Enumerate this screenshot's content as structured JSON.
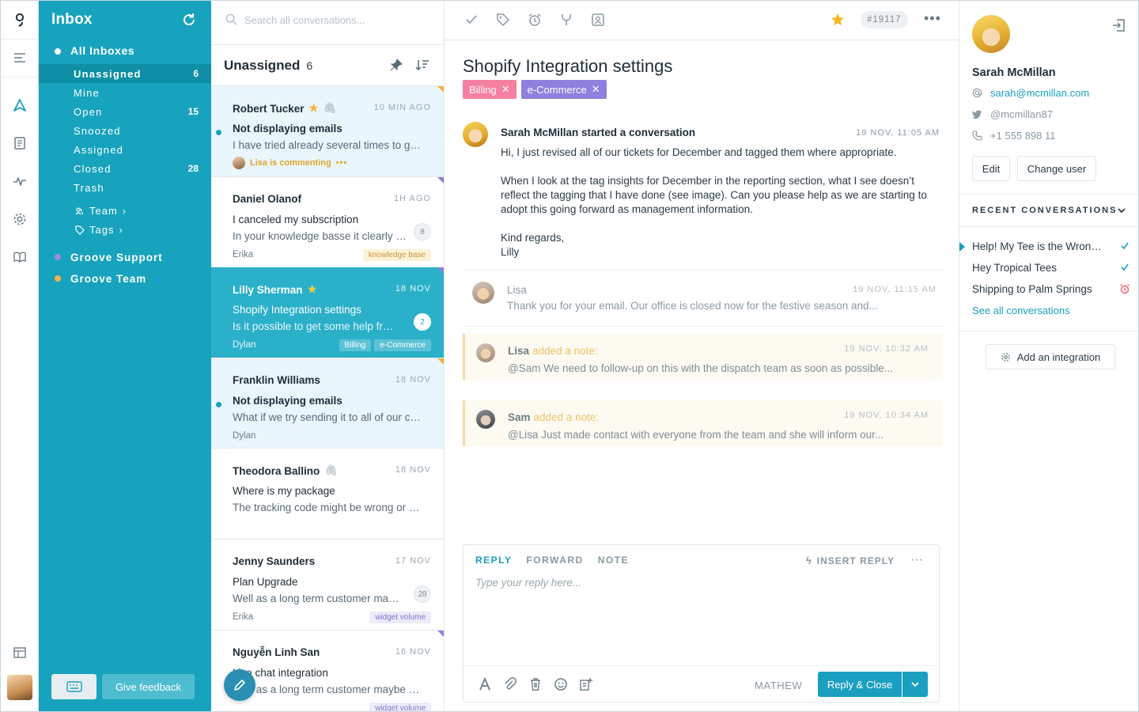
{
  "sidebar": {
    "title": "Inbox",
    "all_inboxes": "All Inboxes",
    "folders": [
      {
        "label": "Unassigned",
        "count": "6"
      },
      {
        "label": "Mine",
        "count": ""
      },
      {
        "label": "Open",
        "count": "15"
      },
      {
        "label": "Snoozed",
        "count": ""
      },
      {
        "label": "Assigned",
        "count": ""
      },
      {
        "label": "Closed",
        "count": "28"
      },
      {
        "label": "Trash",
        "count": ""
      }
    ],
    "team_label": "Team",
    "tags_label": "Tags",
    "groups": [
      "Groove Support",
      "Groove Team"
    ],
    "feedback_label": "Give feedback",
    "colors": {
      "bg": "#17a3bd",
      "active": "#0f8fa6",
      "dot_support": "#9b8ae6",
      "dot_team": "#f3b33c"
    }
  },
  "list": {
    "search_placeholder": "Search all conversations...",
    "title": "Unassigned",
    "count": "6",
    "conversations": [
      {
        "name": "Robert Tucker",
        "time": "10 min ago",
        "subject": "Not displaying emails",
        "preview": "I have tried already several times to get it working",
        "commenting": "Lisa is commenting",
        "commenting_dots": "•••",
        "state": "unread"
      },
      {
        "name": "Daniel Olanof",
        "time": "1h ago",
        "subject": "I canceled my subscription",
        "preview": "In your knowledge basse it clearly says",
        "agent": "Erika",
        "badge": "8",
        "tags": [
          "knowledge base"
        ]
      },
      {
        "name": "Lilly Sherman",
        "time": "18 NOV",
        "subject": "Shopify Integration settings",
        "preview": "Is it possible to get some help from you",
        "agent": "Dylan",
        "badge": "2",
        "tags": [
          "Billing",
          "e-Commerce"
        ],
        "state": "selected"
      },
      {
        "name": "Franklin Williams",
        "time": "18 NOV",
        "subject": "Not displaying emails",
        "preview": "What if we try sending it to all of our customers",
        "agent": "Dylan",
        "state": "unread"
      },
      {
        "name": "Theodora Ballino",
        "time": "18 NOV",
        "subject": "Where is my package",
        "preview": "The tracking code might be wrong or expired"
      },
      {
        "name": "Jenny Saunders",
        "time": "17 NOV",
        "subject": "Plan Upgrade",
        "preview": "Well as a long term customer maybe you could",
        "agent": "Erika",
        "badge": "28",
        "tags": [
          "widget volume"
        ]
      },
      {
        "name": "Nguyễn Linh San",
        "time": "16 NOV",
        "subject": "Live chat integration",
        "preview": "Well as a long term customer maybe you could",
        "tags": [
          "widget volume"
        ]
      }
    ]
  },
  "main": {
    "ticket_number": "#19117",
    "title": "Shopify Integration settings",
    "tags": [
      "Billing",
      "e-Commerce"
    ],
    "thread": {
      "author": "Sarah McMillan started a conversation",
      "time": "19 NOV, 11:05 AM",
      "paragraphs": [
        "Hi, I just revised all of our tickets for December and tagged them where appropriate.",
        "When I look at the tag insights for December in the reporting section, what I see doesn’t reflect the tagging that I have done (see image). Can you please help as we are starting to adopt this going forward as management information.",
        "Kind regards,\nLilly"
      ]
    },
    "reply": {
      "author": "Lisa",
      "time": "19 NOV, 11:15 AM",
      "body": "Thank you for your email. Our office is closed now for the festive season and..."
    },
    "notes": [
      {
        "author": "Lisa",
        "added": "added a note:",
        "time": "19 NOV, 10:32 AM",
        "body": "@Sam We need to follow-up on this with the dispatch team as soon as possible..."
      },
      {
        "author": "Sam",
        "added": "added a note:",
        "time": "19 NOV, 10:34 AM",
        "body": "@Lisa Just made contact with everyone from the team and she will inform our..."
      }
    ],
    "composer": {
      "tabs": [
        "REPLY",
        "FORWARD",
        "NOTE"
      ],
      "insert_reply": "INSERT REPLY",
      "placeholder": "Type your reply here...",
      "agent": "MATHEW",
      "send_label": "Reply & Close"
    }
  },
  "right": {
    "name": "Sarah McMillan",
    "email": "sarah@mcmillan.com",
    "twitter": "@mcmillan87",
    "phone": "+1 555 898 11",
    "edit_label": "Edit",
    "change_user_label": "Change user",
    "recent_title": "RECENT CONVERSATIONS",
    "recent": [
      {
        "label": "Help! My Tee is the Wrong Size",
        "status": "check-icon"
      },
      {
        "label": "Hey Tropical Tees",
        "status": "check-icon"
      },
      {
        "label": "Shipping to Palm Springs",
        "status": "alarm-icon"
      }
    ],
    "see_all": "See all conversations",
    "add_integration": "Add an integration"
  }
}
